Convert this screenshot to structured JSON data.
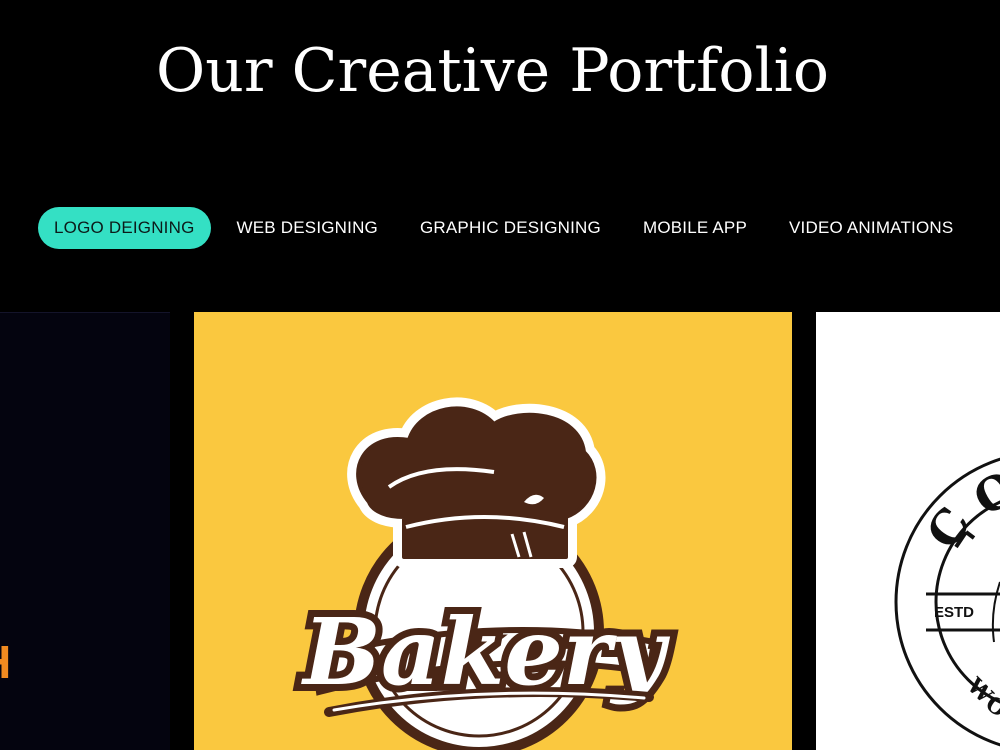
{
  "header": {
    "title": "Our Creative Portfolio"
  },
  "tabs": [
    {
      "label": "LOGO DEIGNING",
      "active": true
    },
    {
      "label": "WEB DESIGNING",
      "active": false
    },
    {
      "label": "GRAPHIC DESIGNING",
      "active": false
    },
    {
      "label": "MOBILE APP",
      "active": false
    },
    {
      "label": "VIDEO ANIMATIONS",
      "active": false
    }
  ],
  "portfolio": {
    "left_card": {
      "visible_text": "H",
      "background": "#04040f",
      "accent": "#f08a20"
    },
    "bakery_card": {
      "logo_text": "Bakery",
      "background": "#fac83f",
      "brown": "#4a2616"
    },
    "right_card": {
      "visible_text": "ESTD",
      "background": "#ffffff"
    }
  },
  "colors": {
    "accent": "#34e0c4",
    "page_background": "#000000"
  }
}
